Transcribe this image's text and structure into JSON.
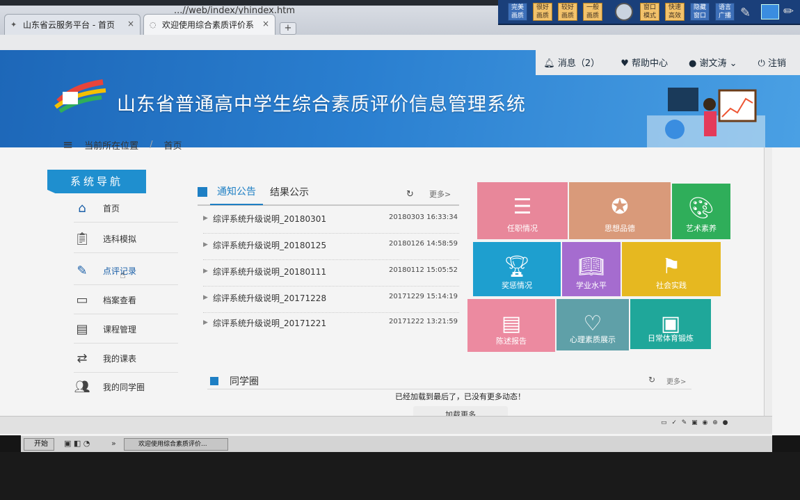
{
  "browser": {
    "url_fragment": "...//web/index/yhindex.htm",
    "tabs": [
      {
        "label": "山东省云服务平台 - 首页",
        "close": "×"
      },
      {
        "label": "欢迎使用综合素质评价系",
        "close": "×"
      }
    ],
    "new_tab": "+"
  },
  "ime_toolbar": {
    "buttons": [
      "完美画质",
      "很好画质",
      "较好画质",
      "一般画质",
      "窗口模式",
      "快速高效",
      "隐藏窗口",
      "语言广播"
    ]
  },
  "topbar": {
    "messages": "消息（2）",
    "help": "帮助中心",
    "user": "谢文涛",
    "logout": "注销"
  },
  "header": {
    "title": "山东省普通高中学生综合素质评价信息管理系统"
  },
  "breadcrumb": {
    "menu_icon": "≡",
    "label": "当前所在位置",
    "current": "首页"
  },
  "sidenav": {
    "title": "系统导航",
    "items": [
      {
        "label": "首页",
        "icon": "home-icon"
      },
      {
        "label": "选科模拟",
        "icon": "clipboard-icon"
      },
      {
        "label": "点评记录",
        "icon": "edit-icon"
      },
      {
        "label": "档案查看",
        "icon": "archive-icon"
      },
      {
        "label": "课程管理",
        "icon": "course-icon"
      },
      {
        "label": "我的课表",
        "icon": "schedule-icon"
      },
      {
        "label": "我的同学圈",
        "icon": "classmates-icon"
      }
    ]
  },
  "notices": {
    "tabs": [
      "通知公告",
      "结果公示"
    ],
    "refresh": "↻",
    "more": "更多>",
    "items": [
      {
        "title": "综评系统升级说明_20180301",
        "date": "20180303 16:33:34"
      },
      {
        "title": "综评系统升级说明_20180125",
        "date": "20180126 14:58:59"
      },
      {
        "title": "综评系统升级说明_20180111",
        "date": "20180112 15:05:52"
      },
      {
        "title": "综评系统升级说明_20171228",
        "date": "20171229 15:14:19"
      },
      {
        "title": "综评系统升级说明_20171221",
        "date": "20171222 13:21:59"
      }
    ]
  },
  "tiles": [
    {
      "label": "任职情况",
      "icon": "document-icon",
      "color": "#e8879a"
    },
    {
      "label": "思想品德",
      "icon": "medal-icon",
      "color": "#d99a7a"
    },
    {
      "label": "艺术素养",
      "icon": "palette-icon",
      "color": "#2fae5a"
    },
    {
      "label": "奖惩情况",
      "icon": "trophy-icon",
      "color": "#1e9fcf"
    },
    {
      "label": "学业水平",
      "icon": "book-icon",
      "color": "#a56ccf"
    },
    {
      "label": "社会实践",
      "icon": "flag-icon",
      "color": "#e6b820"
    },
    {
      "label": "陈述报告",
      "icon": "report-icon",
      "color": "#ec8aa0"
    },
    {
      "label": "心理素质展示",
      "icon": "heart-icon",
      "color": "#5fa0a8"
    },
    {
      "label": "日常体育锻炼",
      "icon": "id-card-icon",
      "color": "#1fa79a"
    }
  ],
  "classmates": {
    "title": "同学圈",
    "refresh": "↻",
    "more": "更多>",
    "status": "已经加载到最后了，已没有更多动态！",
    "load_more": "加载更多"
  },
  "taskbar": {
    "start": "开始",
    "quick": "»",
    "task_item": "欢迎使用综合素质评价..."
  }
}
